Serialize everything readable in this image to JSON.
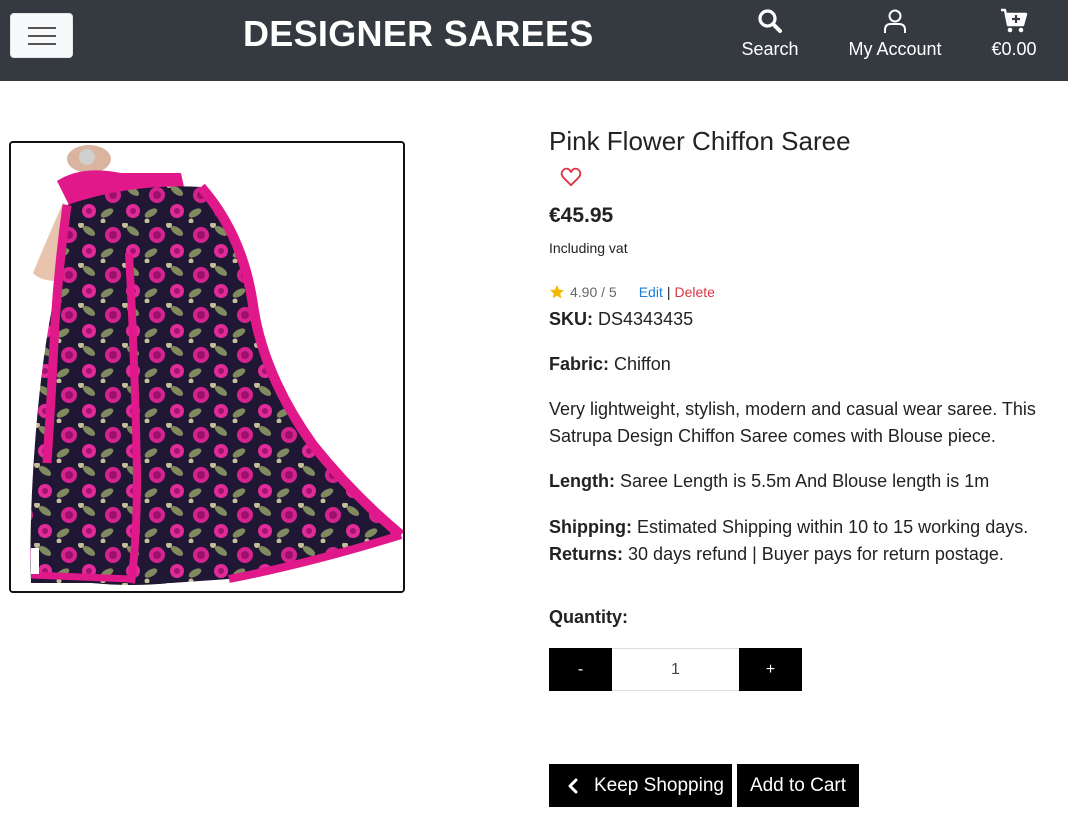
{
  "header": {
    "brand": "DESIGNER SAREES",
    "search_label": "Search",
    "account_label": "My Account",
    "cart_total": "€0.00",
    "icons": [
      "menu-icon",
      "search-icon",
      "user-icon",
      "cart-plus-icon"
    ]
  },
  "product": {
    "image_alt": "Pink Flower Chiffon Saree",
    "name": "Pink Flower Chiffon Saree",
    "price": "€45.95",
    "vat_note": "Including vat",
    "rating": "4.90 / 5",
    "edit_label": "Edit",
    "separator": "|",
    "delete_label": "Delete",
    "sku_label": "SKU:",
    "sku_value": "DS4343435",
    "fabric_label": "Fabric:",
    "fabric_value": "Chiffon",
    "description_line1": "Very lightweight, stylish, modern and casual wear saree. This",
    "description_line2": "Satrupa Design Chiffon Saree comes with Blouse piece.",
    "length_label": "Length:",
    "length_value": "Saree Length is 5.5m And Blouse length is 1m",
    "shipping_label": "Shipping:",
    "shipping_value": "Estimated Shipping within 10 to 15 working days.",
    "returns_label": "Returns:",
    "returns_value": "30 days refund | Buyer pays for return postage."
  },
  "quantity": {
    "label": "Quantity:",
    "decrement": "-",
    "value": "1",
    "increment": "+"
  },
  "actions": {
    "keep_shopping": "Keep Shopping",
    "add_to_cart": "Add to Cart"
  },
  "colors": {
    "navbar": "#343a40",
    "accent_pink": "#e0188a",
    "star": "#f5b800",
    "edit_link": "#1e7fd6",
    "delete_link": "#dc3545"
  }
}
